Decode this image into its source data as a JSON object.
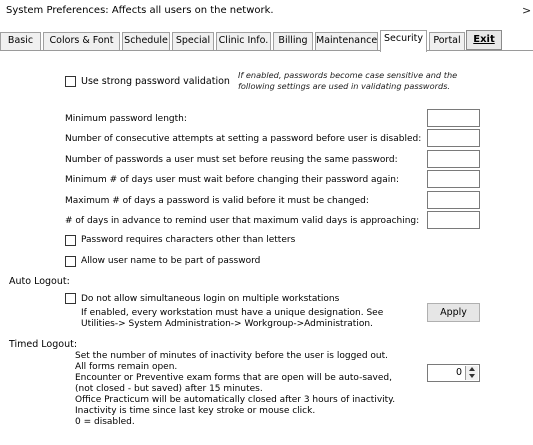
{
  "window": {
    "title": "System Preferences: Affects all users on the network.",
    "close_glyph": ">"
  },
  "tabs": [
    {
      "label": "Basic"
    },
    {
      "label": "Colors & Font"
    },
    {
      "label": "Schedule"
    },
    {
      "label": "Special"
    },
    {
      "label": "Clinic Info."
    },
    {
      "label": "Billing"
    },
    {
      "label": "Maintenance"
    },
    {
      "label": "Security",
      "active": true
    },
    {
      "label": "Portal"
    }
  ],
  "exit_label": "Exit",
  "security": {
    "strong_pw_label": "Use strong password validation",
    "strong_pw_checked": false,
    "strong_pw_hint_1": "If enabled, passwords become case sensitive and the",
    "strong_pw_hint_2": "following settings are used in validating passwords.",
    "settings": [
      {
        "label": "Minimum password length:",
        "value": ""
      },
      {
        "label": "Number of consecutive attempts at setting a password before user is disabled:",
        "value": ""
      },
      {
        "label": "Number of passwords a user must set before reusing the same password:",
        "value": ""
      },
      {
        "label": "Minimum # of days user must wait before changing their password again:",
        "value": ""
      },
      {
        "label": "Maximum # of days a password is valid before it must be changed:",
        "value": ""
      },
      {
        "label": "# of days in advance to remind user that maximum valid days is approaching:",
        "value": ""
      }
    ],
    "require_other_chars_label": "Password requires characters other than letters",
    "require_other_chars_checked": false,
    "allow_username_label": "Allow user name to be part of password",
    "allow_username_checked": false
  },
  "auto_logout": {
    "heading": "Auto Logout:",
    "simultaneous_label": "Do not allow simultaneous login on multiple workstations",
    "simultaneous_checked": false,
    "note_1": "If enabled, every workstation must have a unique designation. See",
    "note_2": "Utilities-> System Administration-> Workgroup->Administration.",
    "apply_label": "Apply"
  },
  "timed_logout": {
    "heading": "Timed Logout:",
    "lines": [
      "Set the number of minutes of inactivity before the user is logged out.",
      "All forms remain open.",
      "Encounter or Preventive exam forms that are open will be auto-saved,",
      "(not closed - but saved) after 15 minutes.",
      "Office Practicum will be automatically closed after 3 hours of inactivity.",
      "Inactivity is time since last key stroke or mouse click.",
      "0 = disabled."
    ],
    "minutes_value": "0"
  }
}
